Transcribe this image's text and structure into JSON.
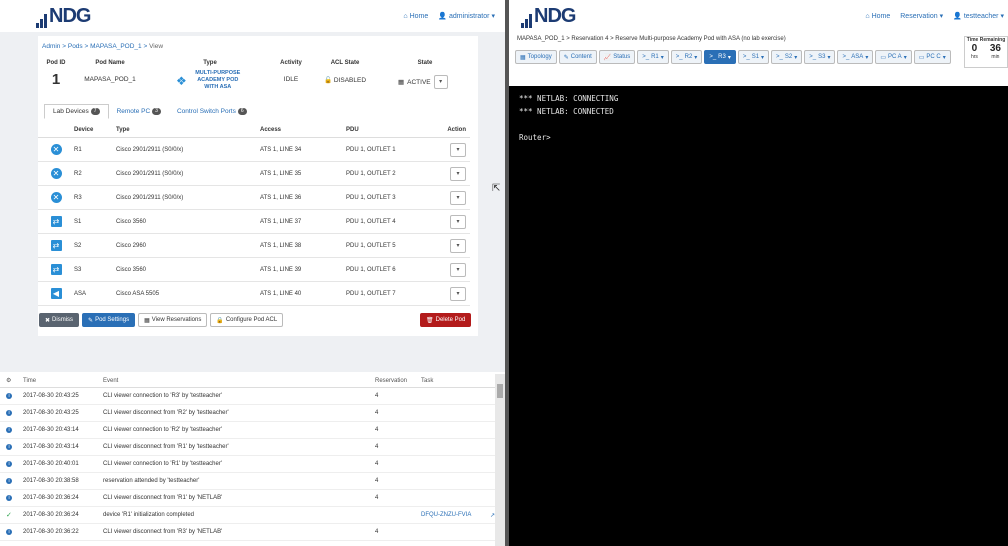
{
  "left": {
    "logo": "NDG",
    "nav": {
      "home": "Home",
      "user": "administrator"
    },
    "breadcrumb": [
      "Admin",
      "Pods",
      "MAPASA_POD_1",
      "View"
    ],
    "pod_headers": [
      "Pod ID",
      "Pod Name",
      "Type",
      "Activity",
      "ACL State",
      "State"
    ],
    "pod": {
      "id": "1",
      "name": "MAPASA_POD_1",
      "type": "MULTI-PURPOSE ACADEMY POD WITH ASA",
      "activity": "IDLE",
      "acl_state": "DISABLED",
      "state": "ACTIVE"
    },
    "tabs": [
      {
        "label": "Lab Devices",
        "count": "7"
      },
      {
        "label": "Remote PC",
        "count": "3"
      },
      {
        "label": "Control Switch Ports",
        "count": "6"
      }
    ],
    "table_headers": [
      "Device",
      "Type",
      "Access",
      "PDU",
      "Action"
    ],
    "devices": [
      {
        "name": "R1",
        "type": "Cisco 2901/2911 (S0/0/x)",
        "access": "ATS 1, LINE 34",
        "pdu": "PDU 1, OUTLET 1",
        "kind": "router"
      },
      {
        "name": "R2",
        "type": "Cisco 2901/2911 (S0/0/x)",
        "access": "ATS 1, LINE 35",
        "pdu": "PDU 1, OUTLET 2",
        "kind": "router"
      },
      {
        "name": "R3",
        "type": "Cisco 2901/2911 (S0/0/x)",
        "access": "ATS 1, LINE 36",
        "pdu": "PDU 1, OUTLET 3",
        "kind": "router"
      },
      {
        "name": "S1",
        "type": "Cisco 3560",
        "access": "ATS 1, LINE 37",
        "pdu": "PDU 1, OUTLET 4",
        "kind": "switch"
      },
      {
        "name": "S2",
        "type": "Cisco 2960",
        "access": "ATS 1, LINE 38",
        "pdu": "PDU 1, OUTLET 5",
        "kind": "switch"
      },
      {
        "name": "S3",
        "type": "Cisco 3560",
        "access": "ATS 1, LINE 39",
        "pdu": "PDU 1, OUTLET 6",
        "kind": "switch"
      },
      {
        "name": "ASA",
        "type": "Cisco ASA 5505",
        "access": "ATS 1, LINE 40",
        "pdu": "PDU 1, OUTLET 7",
        "kind": "firewall"
      }
    ],
    "buttons": {
      "dismiss": "Dismiss",
      "pod_settings": "Pod Settings",
      "view_reservations": "View Reservations",
      "configure_acl": "Configure Pod ACL",
      "delete_pod": "Delete Pod"
    },
    "event_headers": [
      "Time",
      "Event",
      "Reservation",
      "Task"
    ],
    "events": [
      {
        "time": "2017-08-30 20:43:25",
        "event": "CLI viewer connection to 'R3' by 'testteacher'",
        "reservation": "4",
        "task": "",
        "icon": "info"
      },
      {
        "time": "2017-08-30 20:43:25",
        "event": "CLI viewer disconnect from 'R2' by 'testteacher'",
        "reservation": "4",
        "task": "",
        "icon": "info"
      },
      {
        "time": "2017-08-30 20:43:14",
        "event": "CLI viewer connection to 'R2' by 'testteacher'",
        "reservation": "4",
        "task": "",
        "icon": "info"
      },
      {
        "time": "2017-08-30 20:43:14",
        "event": "CLI viewer disconnect from 'R1' by 'testteacher'",
        "reservation": "4",
        "task": "",
        "icon": "info"
      },
      {
        "time": "2017-08-30 20:40:01",
        "event": "CLI viewer connection to 'R1' by 'testteacher'",
        "reservation": "4",
        "task": "",
        "icon": "info"
      },
      {
        "time": "2017-08-30 20:38:58",
        "event": "reservation attended by 'testteacher'",
        "reservation": "4",
        "task": "",
        "icon": "info"
      },
      {
        "time": "2017-08-30 20:36:24",
        "event": "CLI viewer disconnect from 'R1' by 'NETLAB'",
        "reservation": "4",
        "task": "",
        "icon": "info"
      },
      {
        "time": "2017-08-30 20:36:24",
        "event": "device 'R1' initialization completed",
        "reservation": "",
        "task": "DFQU-ZNZU-FVIA",
        "icon": "check"
      },
      {
        "time": "2017-08-30 20:36:22",
        "event": "CLI viewer disconnect from 'R3' by 'NETLAB'",
        "reservation": "4",
        "task": "",
        "icon": "info"
      }
    ]
  },
  "right": {
    "logo": "NDG",
    "nav": {
      "home": "Home",
      "reservation": "Reservation",
      "user": "testteacher"
    },
    "breadcrumb": [
      "MAPASA_POD_1",
      "Reservation 4",
      "Reserve Multi-purpose Academy Pod with ASA (no lab exercise)"
    ],
    "timer": {
      "label": "Time Remaining",
      "hours": "0",
      "hours_unit": "hrs",
      "minutes": "36",
      "minutes_unit": "min"
    },
    "toolbar": [
      {
        "label": "Topology",
        "active": false
      },
      {
        "label": "Content",
        "active": false
      },
      {
        "label": "Status",
        "active": false
      },
      {
        "label": "R1",
        "active": false
      },
      {
        "label": "R2",
        "active": false
      },
      {
        "label": "R3",
        "active": true
      },
      {
        "label": "S1",
        "active": false
      },
      {
        "label": "S2",
        "active": false
      },
      {
        "label": "S3",
        "active": false
      },
      {
        "label": "ASA",
        "active": false
      },
      {
        "label": "PC A",
        "active": false
      },
      {
        "label": "PC C",
        "active": false
      }
    ],
    "terminal": [
      "*** NETLAB: CONNECTING",
      "*** NETLAB: CONNECTED",
      "",
      "Router>"
    ]
  },
  "colors": {
    "brand": "#1c3b73",
    "link": "#2a6fb6",
    "danger": "#b31b1b",
    "success": "#2aa14a"
  }
}
